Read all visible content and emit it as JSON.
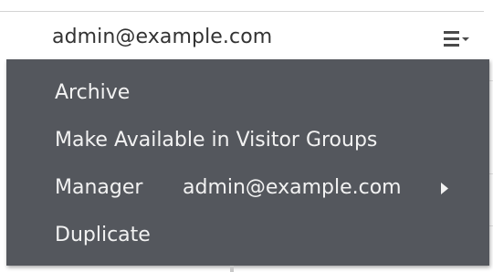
{
  "row": {
    "email": "admin@example.com"
  },
  "menu": {
    "toggle_icon": "menu-lines-icon",
    "items": [
      {
        "label": "Archive"
      },
      {
        "label": "Make Available in Visitor Groups"
      },
      {
        "label": "Manager",
        "value": "admin@example.com",
        "icon": "caret-right-icon"
      },
      {
        "label": "Duplicate"
      }
    ]
  },
  "colors": {
    "menu_background": "#54575d",
    "menu_text": "#f2f2f2",
    "row_text": "#333333"
  }
}
